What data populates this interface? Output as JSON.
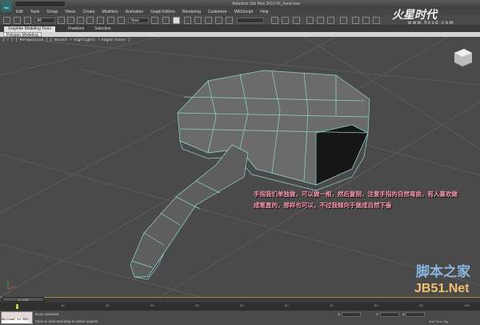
{
  "app": {
    "icon_label": "3ds",
    "title": "Autodesk 3ds Max 2010    05_hand.max"
  },
  "menu": [
    "Edit",
    "Tools",
    "Group",
    "Views",
    "Create",
    "Modifiers",
    "Animation",
    "Graph Editors",
    "Rendering",
    "Customize",
    "MAXScript",
    "Help"
  ],
  "toolbar": {
    "selection_filter": "All",
    "ref_coord": "View",
    "named_sel": ""
  },
  "ribbon": {
    "tabs": [
      "Graphite Modeling Tools",
      "Freeform",
      "Selection"
    ],
    "panel": "Polygon Modeling"
  },
  "viewport": {
    "label": "[ + ] [ Perspective ] [ Smooth + Highlights + Edged Faces ]",
    "annotation": "手指我们单独做，可以做一根，然后复制，注意手指的自然弯曲，有人喜欢做成笔直的，那样也可以，不过我倾向于做成自然下垂"
  },
  "watermarks": {
    "hxsd": "火星时代",
    "hxsd_url": "www.hxsd.com",
    "jb51_cn": "脚本之家",
    "jb51": "JB51.Net"
  },
  "timeline": {
    "position": "0 / 100",
    "ticks": [
      "0",
      "10",
      "20",
      "30",
      "40",
      "50",
      "60",
      "70",
      "80",
      "90",
      "100"
    ]
  },
  "status": {
    "maxscript": "Welcome to MAX",
    "line1": "None Selected",
    "line2": "Click or click-and-drag to select objects",
    "x": "X",
    "y": "Y",
    "z": "Z",
    "time_tag": "Add Time Tag"
  },
  "colors": {
    "viewport": "#4a4a4a",
    "wire": "#8fd6d0",
    "annotation": "#ff9ab0"
  }
}
